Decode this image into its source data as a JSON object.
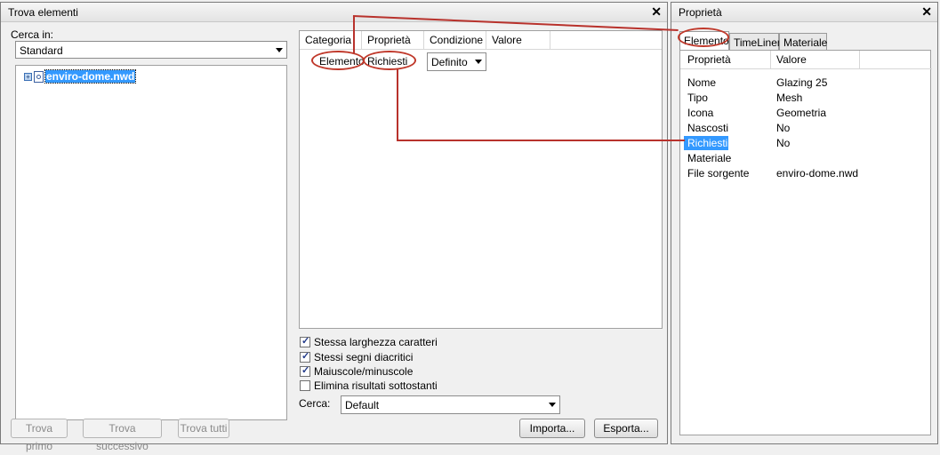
{
  "find_window": {
    "title": "Trova elementi",
    "look_in_label": "Cerca in:",
    "look_in_value": "Standard",
    "tree_item": "enviro-dome.nwd",
    "columns": [
      "Categoria",
      "Proprietà",
      "Condizione",
      "Valore"
    ],
    "row": {
      "category": "Elemento",
      "property": "Richiesti",
      "condition": "Definito"
    },
    "options": [
      {
        "label": "Stessa larghezza caratteri",
        "checked": true
      },
      {
        "label": "Stessi segni diacritici",
        "checked": true
      },
      {
        "label": "Maiuscole/minuscole",
        "checked": true
      },
      {
        "label": "Elimina risultati sottostanti",
        "checked": false
      }
    ],
    "search_label": "Cerca:",
    "search_value": "Default",
    "buttons": {
      "find_first": "Trova primo",
      "find_next": "Trova successivo",
      "find_all": "Trova tutti",
      "import": "Importa...",
      "export": "Esporta..."
    }
  },
  "properties_window": {
    "title": "Proprietà",
    "tabs": [
      "Elemento",
      "TimeLiner",
      "Materiale"
    ],
    "columns": [
      "Proprietà",
      "Valore"
    ],
    "rows": [
      {
        "name": "Nome",
        "value": "Glazing 25"
      },
      {
        "name": "Tipo",
        "value": "Mesh"
      },
      {
        "name": "Icona",
        "value": "Geometria"
      },
      {
        "name": "Nascosti",
        "value": "No"
      },
      {
        "name": "Richiesti",
        "value": "No"
      },
      {
        "name": "Materiale",
        "value": ""
      },
      {
        "name": "File sorgente",
        "value": "enviro-dome.nwd"
      }
    ]
  },
  "colors": {
    "annotation": "#c0392b",
    "selection": "#3399ff"
  }
}
